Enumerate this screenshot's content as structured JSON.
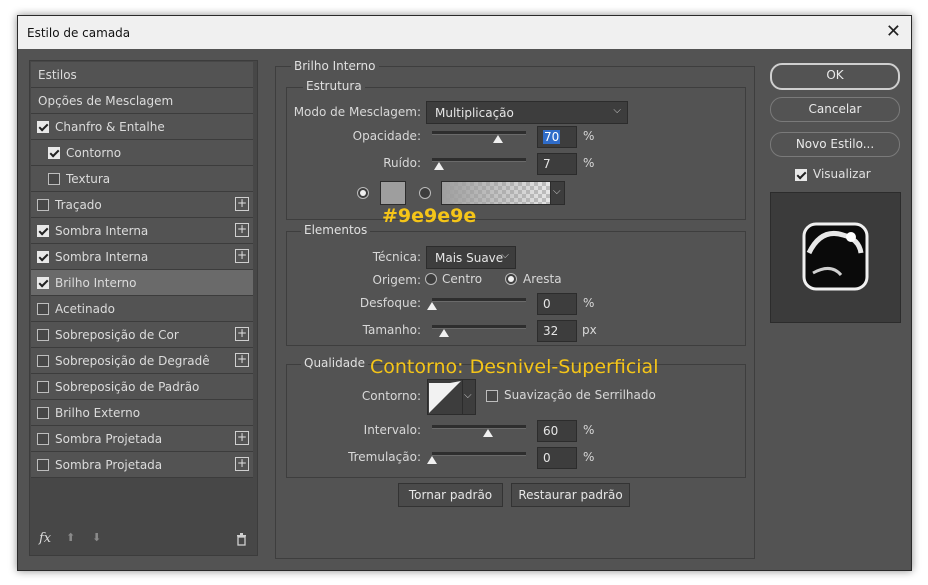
{
  "window": {
    "title": "Estilo de camada",
    "close_glyph": "✕"
  },
  "sidebar": {
    "items": [
      {
        "label": "Estilos",
        "checkbox": false,
        "checked": false,
        "plus": false,
        "indent": false,
        "selected": false
      },
      {
        "label": "Opções de Mesclagem",
        "checkbox": false,
        "checked": false,
        "plus": false,
        "indent": false,
        "selected": false
      },
      {
        "label": "Chanfro & Entalhe",
        "checkbox": true,
        "checked": true,
        "plus": false,
        "indent": false,
        "selected": false
      },
      {
        "label": "Contorno",
        "checkbox": true,
        "checked": true,
        "plus": false,
        "indent": true,
        "selected": false
      },
      {
        "label": "Textura",
        "checkbox": true,
        "checked": false,
        "plus": false,
        "indent": true,
        "selected": false
      },
      {
        "label": "Traçado",
        "checkbox": true,
        "checked": false,
        "plus": true,
        "indent": false,
        "selected": false
      },
      {
        "label": "Sombra Interna",
        "checkbox": true,
        "checked": true,
        "plus": true,
        "indent": false,
        "selected": false
      },
      {
        "label": "Sombra Interna",
        "checkbox": true,
        "checked": true,
        "plus": true,
        "indent": false,
        "selected": false
      },
      {
        "label": "Brilho Interno",
        "checkbox": true,
        "checked": true,
        "plus": false,
        "indent": false,
        "selected": true
      },
      {
        "label": "Acetinado",
        "checkbox": true,
        "checked": false,
        "plus": false,
        "indent": false,
        "selected": false
      },
      {
        "label": "Sobreposição de Cor",
        "checkbox": true,
        "checked": false,
        "plus": true,
        "indent": false,
        "selected": false
      },
      {
        "label": "Sobreposição de Degradê",
        "checkbox": true,
        "checked": false,
        "plus": true,
        "indent": false,
        "selected": false
      },
      {
        "label": "Sobreposição de Padrão",
        "checkbox": true,
        "checked": false,
        "plus": false,
        "indent": false,
        "selected": false
      },
      {
        "label": "Brilho Externo",
        "checkbox": true,
        "checked": false,
        "plus": false,
        "indent": false,
        "selected": false
      },
      {
        "label": "Sombra Projetada",
        "checkbox": true,
        "checked": false,
        "plus": true,
        "indent": false,
        "selected": false
      },
      {
        "label": "Sombra Projetada",
        "checkbox": true,
        "checked": false,
        "plus": true,
        "indent": false,
        "selected": false
      }
    ],
    "footer": {
      "fx": "fx",
      "up_icon": "arrow-up-icon",
      "down_icon": "arrow-down-icon",
      "trash_icon": "trash-icon"
    }
  },
  "panel": {
    "title": "Brilho Interno",
    "estrutura": {
      "title": "Estrutura",
      "blend_label": "Modo de Mesclagem:",
      "blend_value": "Multiplicação",
      "opacity_label": "Opacidade:",
      "opacity_value": "70",
      "opacity_level": 70,
      "noise_label": "Ruído:",
      "noise_value": "7",
      "noise_level": 7,
      "pct": "%",
      "color": "#9e9e9e"
    },
    "elementos": {
      "title": "Elementos",
      "technique_label": "Técnica:",
      "technique_value": "Mais Suave",
      "source_label": "Origem:",
      "source_center": "Centro",
      "source_edge": "Aresta",
      "choke_label": "Desfoque:",
      "choke_value": "0",
      "choke_level": 0,
      "size_label": "Tamanho:",
      "size_value": "32",
      "size_level": 13,
      "px": "px"
    },
    "qualidade": {
      "title": "Qualidade",
      "contour_label": "Contorno:",
      "antialias_label": "Suavização de Serrilhado",
      "range_label": "Intervalo:",
      "range_value": "60",
      "range_level": 60,
      "jitter_label": "Tremulação:",
      "jitter_value": "0",
      "jitter_level": 0
    },
    "make_default": "Tornar padrão",
    "reset_default": "Restaurar padrão"
  },
  "right": {
    "ok": "OK",
    "cancel": "Cancelar",
    "new_style": "Novo Estilo...",
    "preview_label": "Visualizar"
  },
  "annotations": {
    "color_note": "#9e9e9e",
    "contour_note": "Contorno: Desnivel-Superficial"
  },
  "colors": {
    "accent_text": "#f5c518",
    "selection": "#2f6cc9"
  }
}
